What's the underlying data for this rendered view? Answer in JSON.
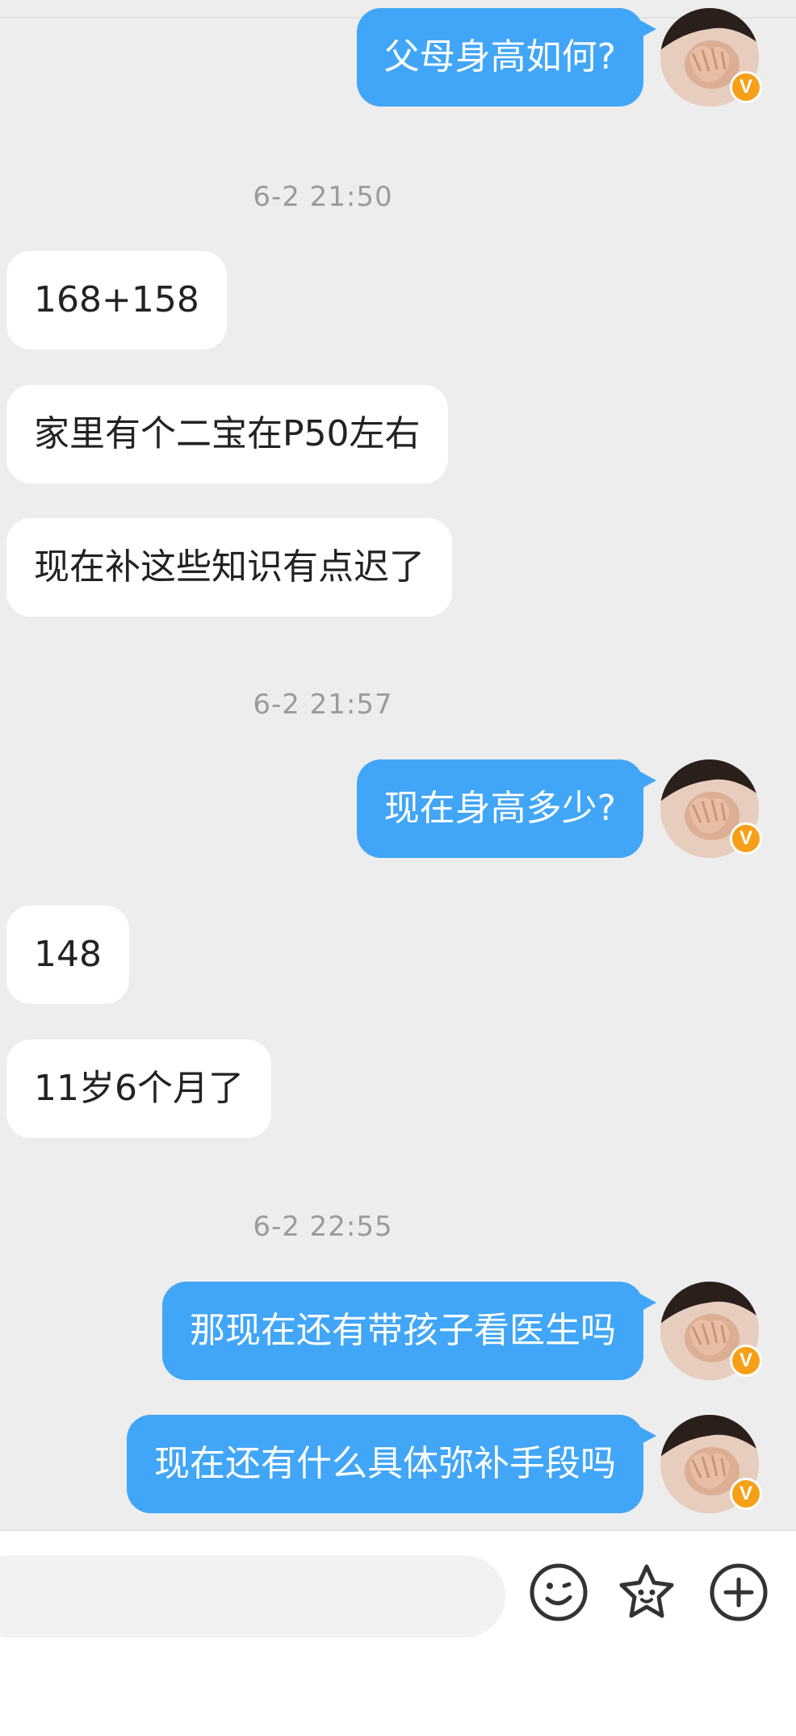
{
  "messages": [
    {
      "type": "outgoing",
      "text": "父母身高如何?"
    },
    {
      "type": "timestamp",
      "text": "6-2 21:50"
    },
    {
      "type": "incoming",
      "text": "168+158"
    },
    {
      "type": "incoming",
      "text": "家里有个二宝在P50左右"
    },
    {
      "type": "incoming",
      "text": "现在补这些知识有点迟了"
    },
    {
      "type": "timestamp",
      "text": "6-2 21:57"
    },
    {
      "type": "outgoing",
      "text": "现在身高多少?"
    },
    {
      "type": "incoming",
      "text": "148"
    },
    {
      "type": "incoming",
      "text": "11岁6个月了"
    },
    {
      "type": "timestamp",
      "text": "6-2 22:55"
    },
    {
      "type": "outgoing",
      "text": "那现在还有带孩子看医生吗"
    },
    {
      "type": "outgoing",
      "text": "现在还有什么具体弥补手段吗"
    }
  ],
  "avatar": {
    "badge": "V",
    "badge_color": "#f6a019"
  },
  "colors": {
    "outgoing_bubble": "#41a6f7",
    "incoming_bubble": "#ffffff",
    "chat_background": "#ededed"
  },
  "input_bar": {
    "placeholder": "",
    "icons": [
      "emoji-icon",
      "sticker-icon",
      "add-icon"
    ]
  }
}
